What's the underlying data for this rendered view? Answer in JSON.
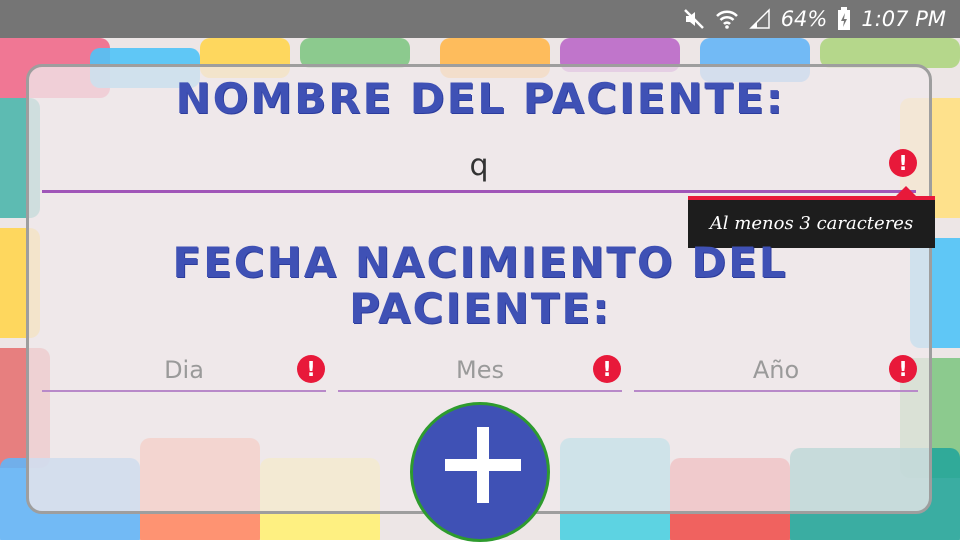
{
  "status_bar": {
    "battery": "64%",
    "time": "1:07 PM",
    "icons": [
      "mute-icon",
      "wifi-icon",
      "signal-icon",
      "battery-icon"
    ]
  },
  "form": {
    "name_title": "NOMBRE DEL PACIENTE:",
    "name_value": "q",
    "name_error": "Al menos 3 caracteres",
    "date_title_line1": "FECHA NACIMIENTO DEL",
    "date_title_line2": "PACIENTE:",
    "day_placeholder": "Dia",
    "month_placeholder": "Mes",
    "year_placeholder": "Año",
    "add_button_icon": "plus-icon"
  },
  "colors": {
    "accent": "#3f51b5",
    "error": "#e8193a",
    "underline": "#a055b8",
    "fab_border": "#2e9b2e"
  }
}
